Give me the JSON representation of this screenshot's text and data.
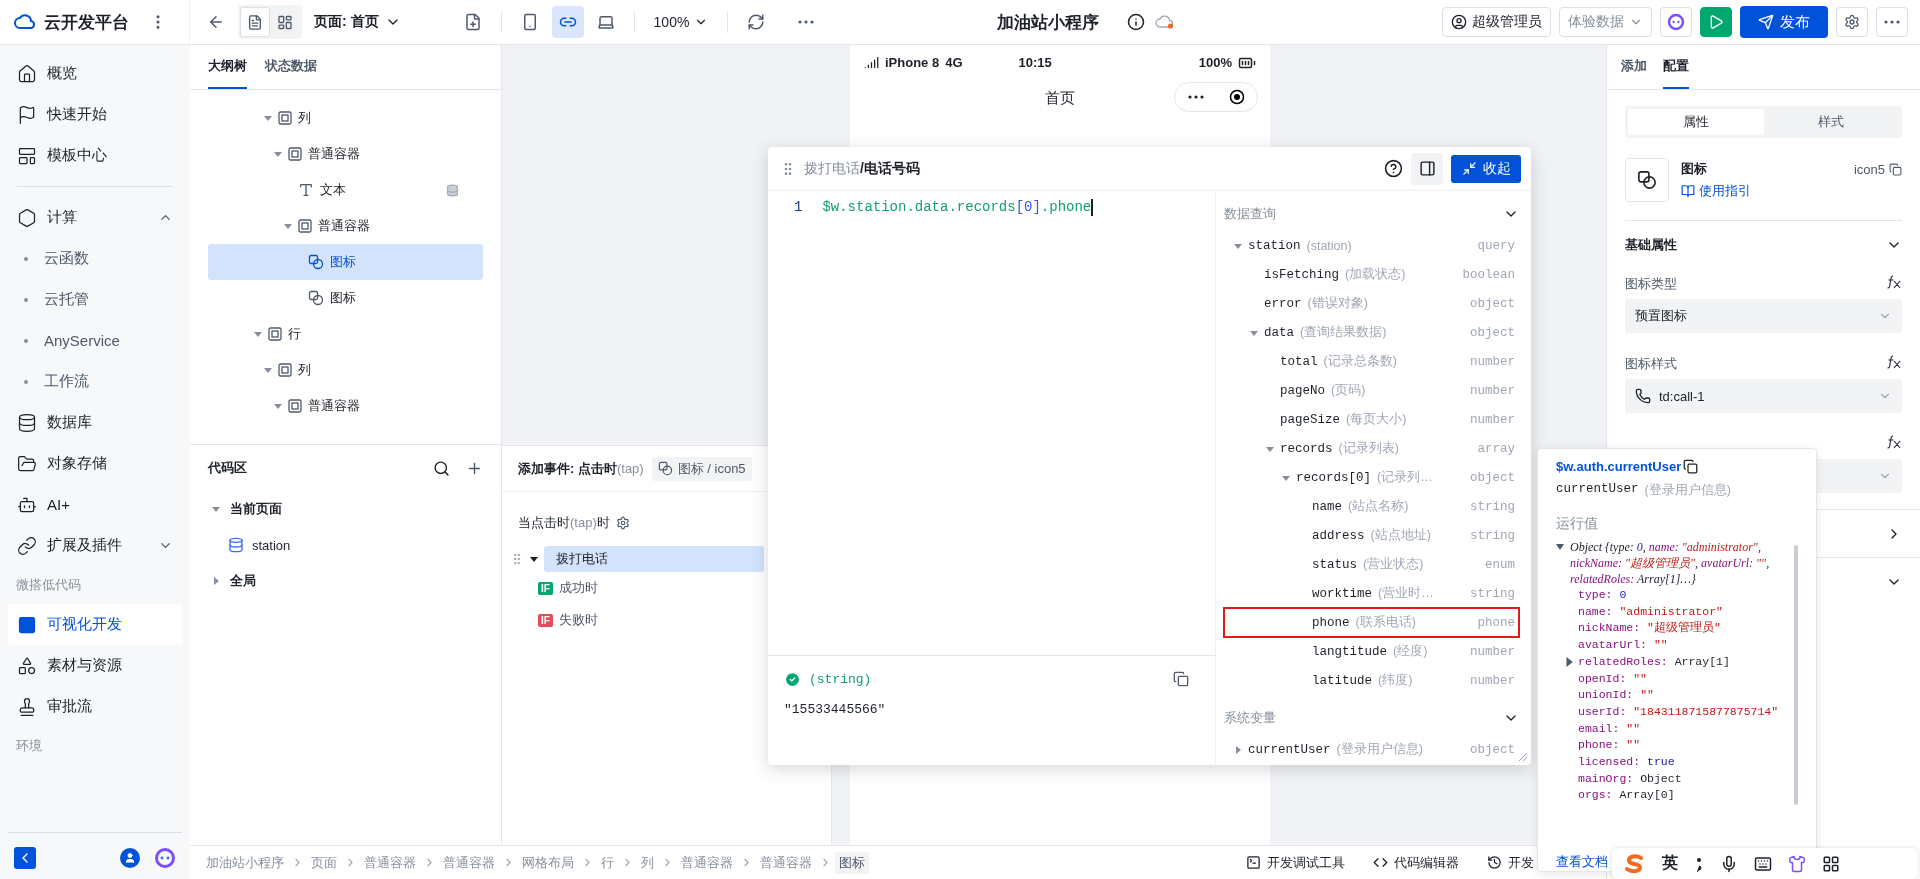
{
  "topbar": {
    "brand": "云开发平台",
    "view_toggles": [
      {
        "selected": true
      },
      {
        "selected": false
      }
    ],
    "page_select": {
      "label": "页面:",
      "value": "首页"
    },
    "devices": [
      {
        "kind": "mobile",
        "selected": false
      },
      {
        "kind": "miniprogram",
        "selected": true
      },
      {
        "kind": "desktop",
        "selected": false
      }
    ],
    "zoom": "100%",
    "title": "加油站小程序",
    "user_button": "超级管理员",
    "data_select": "体验数据",
    "publish_button": "发布"
  },
  "sidebar": {
    "items": [
      {
        "kind": "nav",
        "label": "概览",
        "selected": false
      },
      {
        "kind": "nav",
        "label": "快速开始",
        "selected": false
      },
      {
        "kind": "nav",
        "label": "模板中心",
        "selected": false
      },
      {
        "kind": "divider"
      },
      {
        "kind": "group",
        "label": "计算",
        "selected": false,
        "expanded": true,
        "children": [
          {
            "label": "云函数",
            "selected": false
          },
          {
            "label": "云托管",
            "selected": false
          },
          {
            "label": "AnyService",
            "selected": false
          },
          {
            "label": "工作流",
            "selected": false
          }
        ]
      },
      {
        "kind": "nav",
        "label": "数据库",
        "selected": false
      },
      {
        "kind": "nav",
        "label": "对象存储",
        "selected": false
      },
      {
        "kind": "nav",
        "label": "AI+",
        "selected": false
      },
      {
        "kind": "group",
        "label": "扩展及插件",
        "selected": false,
        "expanded": false
      },
      {
        "kind": "section",
        "label": "微搭低代码"
      },
      {
        "kind": "nav",
        "label": "可视化开发",
        "selected": true
      },
      {
        "kind": "nav",
        "label": "素材与资源",
        "selected": false
      },
      {
        "kind": "nav",
        "label": "审批流",
        "selected": false
      },
      {
        "kind": "section",
        "label": "环境"
      }
    ]
  },
  "outline_tabs": [
    {
      "label": "大纲树",
      "selected": true
    },
    {
      "label": "状态数据",
      "selected": false
    }
  ],
  "outline": [
    {
      "children": [
        {
          "label": "列",
          "kind": "container",
          "selected": false,
          "expanded": true,
          "children": [
            {
              "label": "普通容器",
              "kind": "container",
              "selected": false,
              "expanded": true,
              "children": [
                {
                  "label": "文本",
                  "kind": "text",
                  "selected": false,
                  "data_bound": true
                },
                {
                  "label": "普通容器",
                  "kind": "container",
                  "selected": false,
                  "expanded": true,
                  "children": [
                    {
                      "label": "图标",
                      "kind": "icon",
                      "selected": true
                    },
                    {
                      "label": "图标",
                      "kind": "icon",
                      "selected": false
                    }
                  ]
                }
              ]
            }
          ]
        }
      ]
    },
    {
      "label": "行",
      "kind": "container",
      "selected": false,
      "expanded": true,
      "children": [
        {
          "label": "列",
          "kind": "container",
          "selected": false,
          "expanded": true,
          "children": [
            {
              "label": "普通容器",
              "kind": "container",
              "selected": false,
              "expanded": true
            }
          ]
        }
      ]
    }
  ],
  "code_area": {
    "title": "代码区",
    "groups": [
      {
        "label": "当前页面",
        "expanded": true,
        "items": [
          {
            "label": "station"
          }
        ]
      },
      {
        "label": "全局",
        "expanded": false
      }
    ]
  },
  "events": {
    "title_parts": [
      {
        "text": "添加事件: 点击时",
        "muted": false
      },
      {
        "text": "(tap)",
        "muted": true
      }
    ],
    "target": "图标 / icon5",
    "trigger_parts": [
      {
        "text": "当点击时",
        "muted": false
      },
      {
        "text": "(tap)",
        "muted": true
      },
      {
        "text": "时",
        "muted": false
      }
    ],
    "actions": [
      {
        "label": "拨打电话",
        "expanded": true,
        "selected": true,
        "branches": [
          {
            "kind": "success",
            "badge": "IF",
            "label": "成功时"
          },
          {
            "kind": "fail",
            "badge": "IF",
            "label": "失败时"
          }
        ]
      }
    ]
  },
  "phone": {
    "carrier": "iPhone 8",
    "network": "4G",
    "time": "10:15",
    "battery": "100%",
    "page_title": "首页"
  },
  "binding_popup": {
    "path_parts": [
      {
        "text": "拨打电话",
        "muted": true
      },
      {
        "text": "/",
        "muted": false
      },
      {
        "text": "电话号码",
        "muted": false
      }
    ],
    "collapse_button": "收起",
    "line_numbers": [
      "1"
    ],
    "code_tokens": [
      {
        "text": "$w.station.data.records",
        "kind": "ident"
      },
      {
        "text": "[0]",
        "kind": "index"
      },
      {
        "text": ".phone",
        "kind": "ident"
      }
    ],
    "result": {
      "type": "(string)",
      "value": "\"15533445566\""
    },
    "sections": [
      {
        "title": "数据查询",
        "expanded": true,
        "tree": [
          {
            "name": "station",
            "desc": "(station)",
            "type": "query",
            "expanded": true,
            "highlighted": false,
            "children": [
              {
                "name": "isFetching",
                "desc": "(加载状态)",
                "type": "boolean",
                "highlighted": false
              },
              {
                "name": "error",
                "desc": "(错误对象)",
                "type": "object",
                "highlighted": false
              },
              {
                "name": "data",
                "desc": "(查询结果数据)",
                "type": "object",
                "expanded": true,
                "highlighted": false,
                "children": [
                  {
                    "name": "total",
                    "desc": "(记录总条数)",
                    "type": "number",
                    "highlighted": false
                  },
                  {
                    "name": "pageNo",
                    "desc": "(页码)",
                    "type": "number",
                    "highlighted": false
                  },
                  {
                    "name": "pageSize",
                    "desc": "(每页大小)",
                    "type": "number",
                    "highlighted": false
                  },
                  {
                    "name": "records",
                    "desc": "(记录列表)",
                    "type": "array",
                    "expanded": true,
                    "highlighted": false,
                    "children": [
                      {
                        "name": "records[0]",
                        "desc": "(记录列…",
                        "type": "object",
                        "expanded": true,
                        "highlighted": false,
                        "children": [
                          {
                            "name": "name",
                            "desc": "(站点名称)",
                            "type": "string",
                            "highlighted": false
                          },
                          {
                            "name": "address",
                            "desc": "(站点地址)",
                            "type": "string",
                            "highlighted": false
                          },
                          {
                            "name": "status",
                            "desc": "(营业状态)",
                            "type": "enum",
                            "highlighted": false
                          },
                          {
                            "name": "worktime",
                            "desc": "(营业时…",
                            "type": "string",
                            "highlighted": false
                          },
                          {
                            "name": "phone",
                            "desc": "(联系电话)",
                            "type": "phone",
                            "highlighted": true
                          },
                          {
                            "name": "langtitude",
                            "desc": "(经度)",
                            "type": "number",
                            "highlighted": false
                          },
                          {
                            "name": "latitude",
                            "desc": "(纬度)",
                            "type": "number",
                            "highlighted": false
                          }
                        ]
                      }
                    ]
                  }
                ]
              }
            ]
          }
        ]
      },
      {
        "title": "系统变量",
        "expanded": true,
        "tree": [
          {
            "name": "currentUser",
            "desc": "(登录用户信息)",
            "type": "object",
            "expanded": false,
            "highlighted": false
          }
        ]
      }
    ]
  },
  "user_popup": {
    "path": "$w.auth.currentUser",
    "name": "currentUser",
    "desc": "(登录用户信息)",
    "section": "运行值",
    "expanded": true,
    "summary_parts": [
      {
        "text": "Object {type: ",
        "kind": "plain"
      },
      {
        "text": "0",
        "kind": "number"
      },
      {
        "text": ", ",
        "kind": "plain"
      },
      {
        "text": "name: ",
        "kind": "key"
      },
      {
        "text": "\"administrator\"",
        "kind": "string"
      },
      {
        "text": ", ",
        "kind": "plain"
      },
      {
        "text": "nickName: ",
        "kind": "key"
      },
      {
        "text": "\"超级管理员\"",
        "kind": "string"
      },
      {
        "text": ", ",
        "kind": "plain"
      },
      {
        "text": "avatarUrl: ",
        "kind": "key"
      },
      {
        "text": "\"\"",
        "kind": "string"
      },
      {
        "text": ", ",
        "kind": "plain"
      },
      {
        "text": "relatedRoles: ",
        "kind": "key"
      },
      {
        "text": "Array[1]…}",
        "kind": "plain"
      }
    ],
    "props": [
      {
        "key": "type:",
        "value": "0",
        "kind": "number",
        "expandable": false
      },
      {
        "key": "name:",
        "value": "\"administrator\"",
        "kind": "string",
        "expandable": false
      },
      {
        "key": "nickName:",
        "value": "\"超级管理员\"",
        "kind": "string",
        "expandable": false
      },
      {
        "key": "avatarUrl:",
        "value": "\"\"",
        "kind": "string",
        "expandable": false
      },
      {
        "key": "relatedRoles:",
        "value": "Array[1]",
        "kind": "object",
        "expandable": true
      },
      {
        "key": "openId:",
        "value": "\"\"",
        "kind": "string",
        "expandable": false
      },
      {
        "key": "unionId:",
        "value": "\"\"",
        "kind": "string",
        "expandable": false
      },
      {
        "key": "userId:",
        "value": "\"1843118715877875714\"",
        "kind": "string",
        "expandable": false
      },
      {
        "key": "email:",
        "value": "\"\"",
        "kind": "string",
        "expandable": false
      },
      {
        "key": "phone:",
        "value": "\"\"",
        "kind": "string",
        "expandable": false
      },
      {
        "key": "licensed:",
        "value": "true",
        "kind": "boolean",
        "expandable": false
      },
      {
        "key": "mainOrg:",
        "value": "Object",
        "kind": "object",
        "expandable": false
      },
      {
        "key": "orgs:",
        "value": "Array[0]",
        "kind": "object",
        "expandable": false
      }
    ],
    "doc_link": "查看文档"
  },
  "right_panel": {
    "tabs": [
      {
        "label": "添加",
        "selected": false
      },
      {
        "label": "配置",
        "selected": true
      }
    ],
    "segments": [
      {
        "label": "属性",
        "selected": true
      },
      {
        "label": "样式",
        "selected": false
      }
    ],
    "component": {
      "name": "图标",
      "id": "icon5",
      "guide": "使用指引"
    },
    "section": {
      "title": "基础属性",
      "expanded": true
    },
    "fields": [
      {
        "kind": "select",
        "label": "图标类型",
        "value": "预置图标"
      },
      {
        "kind": "icon_select",
        "label": "图标样式",
        "value": "td:call-1"
      },
      {
        "kind": "select"
      }
    ],
    "collapsed_sections": [
      {
        "expanded": false
      },
      {
        "expanded": true
      }
    ]
  },
  "status_bar": {
    "breadcrumb": [
      {
        "label": "加油站小程序",
        "selected": false
      },
      {
        "label": "页面",
        "selected": false
      },
      {
        "label": "普通容器",
        "selected": false
      },
      {
        "label": "普通容器",
        "selected": false
      },
      {
        "label": "网格布局",
        "selected": false
      },
      {
        "label": "行",
        "selected": false
      },
      {
        "label": "列",
        "selected": false
      },
      {
        "label": "普通容器",
        "selected": false
      },
      {
        "label": "普通容器",
        "selected": false
      },
      {
        "label": "图标",
        "selected": true
      }
    ],
    "tools": [
      "开发调试工具",
      "代码编辑器",
      "开发"
    ]
  },
  "ime": {
    "mode": "英"
  }
}
